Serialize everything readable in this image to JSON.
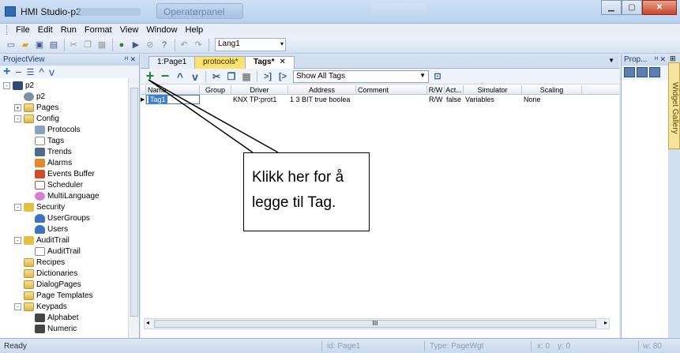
{
  "window": {
    "title": "HMI Studio-p2",
    "blurred_title": "Operatørpanel"
  },
  "menu": [
    "File",
    "Edit",
    "Run",
    "Format",
    "View",
    "Window",
    "Help"
  ],
  "toolbar": {
    "language_value": "Lang1"
  },
  "project_view": {
    "title": "ProjectView",
    "tree": [
      {
        "label": "p2",
        "icon": "monitor-icon",
        "depth": 0,
        "expander": "-"
      },
      {
        "label": "p2",
        "icon": "gear-icon",
        "depth": 1,
        "expander": ""
      },
      {
        "label": "Pages",
        "icon": "folder-icon",
        "depth": 1,
        "expander": "+"
      },
      {
        "label": "Config",
        "icon": "folder-icon",
        "depth": 1,
        "expander": "-"
      },
      {
        "label": "Protocols",
        "icon": "protocols-icon",
        "depth": 2,
        "expander": ""
      },
      {
        "label": "Tags",
        "icon": "tags-icon",
        "depth": 2,
        "expander": ""
      },
      {
        "label": "Trends",
        "icon": "trends-icon",
        "depth": 2,
        "expander": ""
      },
      {
        "label": "Alarms",
        "icon": "alarms-icon",
        "depth": 2,
        "expander": ""
      },
      {
        "label": "Events Buffer",
        "icon": "events-buffer-icon",
        "depth": 2,
        "expander": ""
      },
      {
        "label": "Scheduler",
        "icon": "scheduler-icon",
        "depth": 2,
        "expander": ""
      },
      {
        "label": "MultiLanguage",
        "icon": "multilanguage-icon",
        "depth": 2,
        "expander": ""
      },
      {
        "label": "Security",
        "icon": "security-folder-icon",
        "depth": 1,
        "expander": "-"
      },
      {
        "label": "UserGroups",
        "icon": "usergroups-icon",
        "depth": 2,
        "expander": ""
      },
      {
        "label": "Users",
        "icon": "users-icon",
        "depth": 2,
        "expander": ""
      },
      {
        "label": "AuditTrail",
        "icon": "audittrail-folder-icon",
        "depth": 1,
        "expander": "-"
      },
      {
        "label": "AuditTrail",
        "icon": "audittrail-icon",
        "depth": 2,
        "expander": ""
      },
      {
        "label": "Recipes",
        "icon": "folder-icon",
        "depth": 1,
        "expander": ""
      },
      {
        "label": "Dictionaries",
        "icon": "folder-icon",
        "depth": 1,
        "expander": ""
      },
      {
        "label": "DialogPages",
        "icon": "folder-icon",
        "depth": 1,
        "expander": ""
      },
      {
        "label": "Page Templates",
        "icon": "folder-icon",
        "depth": 1,
        "expander": ""
      },
      {
        "label": "Keypads",
        "icon": "folder-icon",
        "depth": 1,
        "expander": "-"
      },
      {
        "label": "Alphabet",
        "icon": "keypad-icon",
        "depth": 2,
        "expander": ""
      },
      {
        "label": "Numeric",
        "icon": "keypad-icon",
        "depth": 2,
        "expander": ""
      }
    ]
  },
  "tabs": [
    {
      "label": "1:Page1"
    },
    {
      "label": "protocols*"
    },
    {
      "label": "Tags*",
      "active": true
    }
  ],
  "tag_filter": "Show All Tags",
  "grid": {
    "columns": [
      "Name",
      "Group",
      "Driver",
      "Address",
      "Comment",
      "R/W",
      "Act...",
      "Simulator",
      "Scaling"
    ],
    "rows": [
      [
        "Tag1",
        "",
        "KNX TP:prot1",
        "1 3 BIT true boolea",
        "",
        "R/W",
        "false",
        "Variables",
        "None"
      ]
    ]
  },
  "scroll_label": "III",
  "callout": {
    "text": "Klikk her for å legge til Tag."
  },
  "properties": {
    "title": "Prop..."
  },
  "widget_gallery": "Widget Gallery",
  "status": {
    "ready": "Ready",
    "id": "id: Page1",
    "type": "Type: PageWgt",
    "x": "x: 0",
    "y": "y: 0",
    "w": "w: 80"
  }
}
